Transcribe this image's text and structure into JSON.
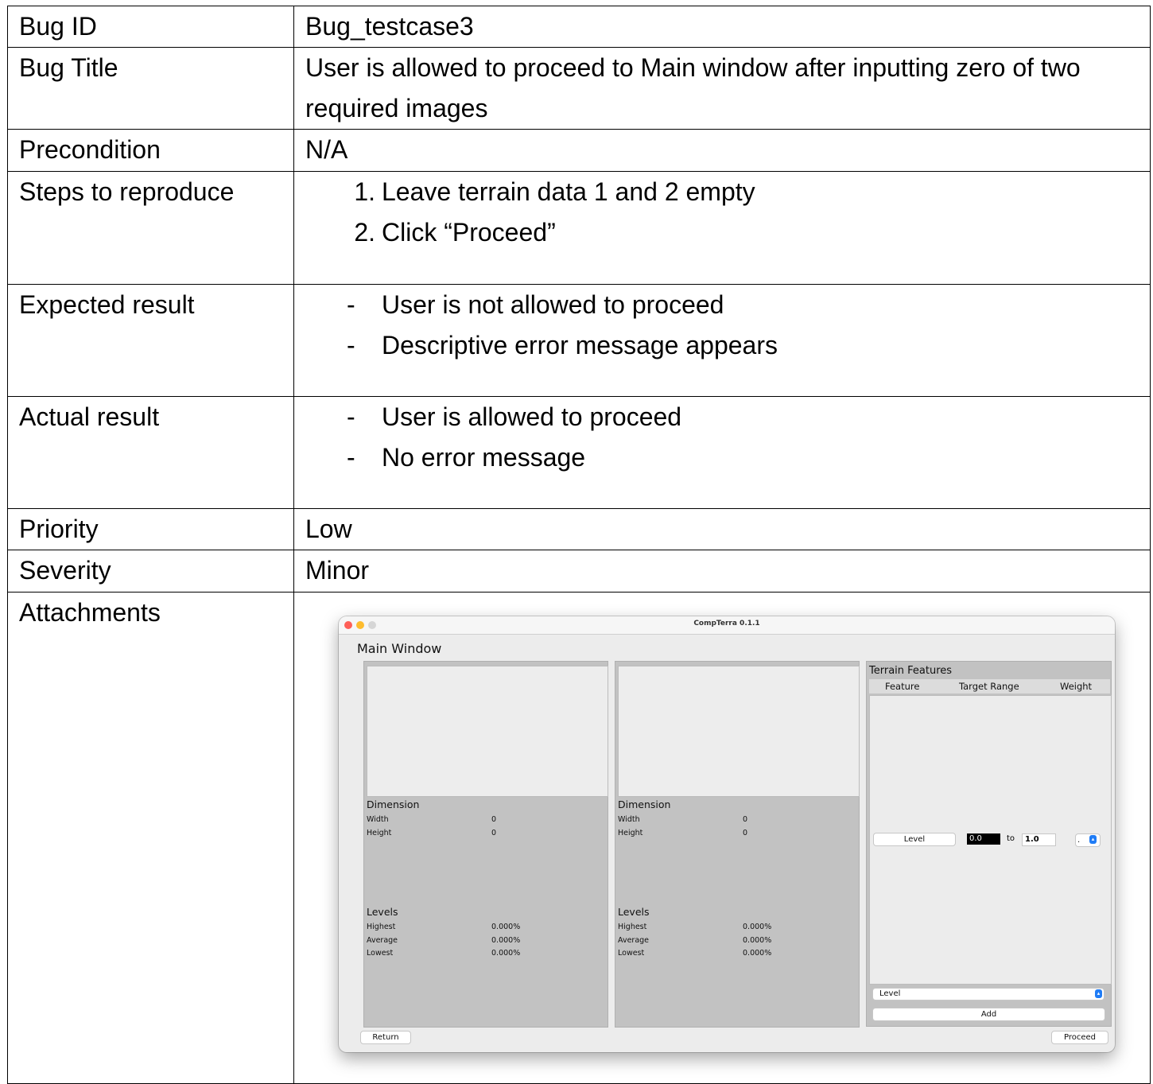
{
  "rows": {
    "bug_id": {
      "label": "Bug ID",
      "value": "Bug_testcase3"
    },
    "bug_title": {
      "label": "Bug Title",
      "value": "User is allowed to proceed to Main window after inputting zero of two required images"
    },
    "precondition": {
      "label": "Precondition",
      "value": "N/A"
    },
    "steps": {
      "label": "Steps to reproduce",
      "items": [
        {
          "marker": "1.",
          "text": "Leave terrain data 1 and 2 empty"
        },
        {
          "marker": "2.",
          "text": "Click “Proceed”"
        }
      ]
    },
    "expected": {
      "label": "Expected result",
      "items": [
        {
          "marker": "-",
          "text": "User is not allowed to proceed"
        },
        {
          "marker": "-",
          "text": "Descriptive error message appears"
        }
      ]
    },
    "actual": {
      "label": "Actual result",
      "items": [
        {
          "marker": "-",
          "text": "User is allowed to proceed"
        },
        {
          "marker": "-",
          "text": "No error message"
        }
      ]
    },
    "priority": {
      "label": "Priority",
      "value": "Low"
    },
    "severity": {
      "label": "Severity",
      "value": "Minor"
    },
    "attachments": {
      "label": "Attachments"
    }
  },
  "screenshot": {
    "window_title": "CompTerra 0.1.1",
    "main_label": "Main Window",
    "panels": [
      {
        "dimension_heading": "Dimension",
        "width_label": "Width",
        "width_value": "0",
        "height_label": "Height",
        "height_value": "0",
        "levels_heading": "Levels",
        "highest_label": "Highest",
        "highest_value": "0.000%",
        "average_label": "Average",
        "average_value": "0.000%",
        "lowest_label": "Lowest",
        "lowest_value": "0.000%"
      },
      {
        "dimension_heading": "Dimension",
        "width_label": "Width",
        "width_value": "0",
        "height_label": "Height",
        "height_value": "0",
        "levels_heading": "Levels",
        "highest_label": "Highest",
        "highest_value": "0.000%",
        "average_label": "Average",
        "average_value": "0.000%",
        "lowest_label": "Lowest",
        "lowest_value": "0.000%"
      }
    ],
    "terrain": {
      "heading": "Terrain Features",
      "col_feature": "Feature",
      "col_target_range": "Target Range",
      "col_weight": "Weight",
      "row_feature": "Level",
      "range_min": "0.0",
      "range_to": "to",
      "range_max": "1.0",
      "weight_value": ".",
      "feature_select": "Level",
      "add_label": "Add"
    },
    "return_label": "Return",
    "proceed_label": "Proceed",
    "accent": "#1f7cf6"
  }
}
